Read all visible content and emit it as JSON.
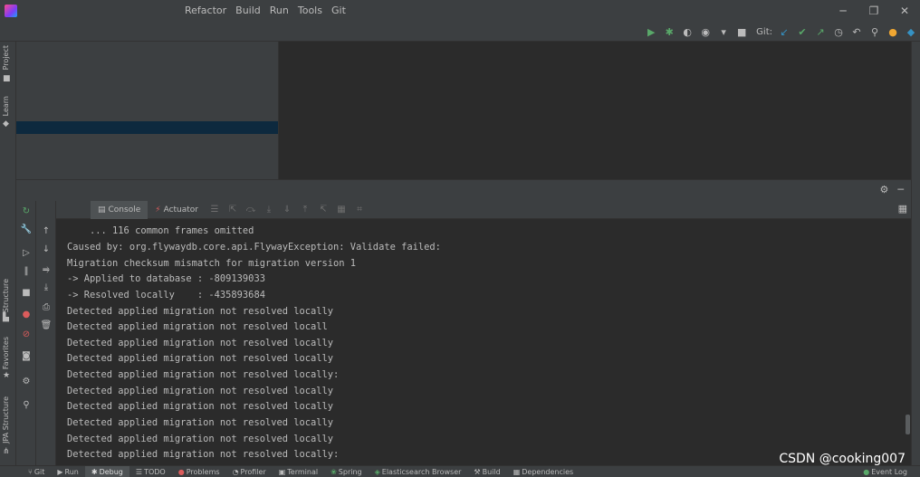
{
  "menu": [
    "Refactor",
    "Build",
    "Run",
    "Tools",
    "Git"
  ],
  "window_controls": [
    "─",
    "❐",
    "✕"
  ],
  "toolbar": {
    "git_label": "Git:"
  },
  "left_strip": {
    "tabs": [
      "Project",
      "Learn",
      "Structure",
      "Favorites",
      "JPA Structure"
    ]
  },
  "debug": {
    "tabs": [
      {
        "label": "Console",
        "icon": "console-icon"
      },
      {
        "label": "Actuator",
        "icon": "actuator-icon"
      }
    ]
  },
  "console": {
    "lines": [
      "    ... 116 common frames omitted",
      "Caused by: org.flywaydb.core.api.FlywayException: Validate failed:",
      "Migration checksum mismatch for migration version 1",
      "-> Applied to database : -809139033",
      "-> Resolved locally    : -435893684",
      "Detected applied migration not resolved locally",
      "Detected applied migration not resolved locall",
      "Detected applied migration not resolved locally",
      "Detected applied migration not resolved locally",
      "Detected applied migration not resolved locally:",
      "Detected applied migration not resolved locally",
      "Detected applied migration not resolved locally",
      "Detected applied migration not resolved locally",
      "Detected applied migration not resolved locally",
      "Detected applied migration not resolved locally:"
    ]
  },
  "bottom_tabs": [
    {
      "label": "Git",
      "icon": "git-icon",
      "active": false
    },
    {
      "label": "Run",
      "icon": "run-icon",
      "active": false
    },
    {
      "label": "Debug",
      "icon": "debug-icon",
      "active": true
    },
    {
      "label": "TODO",
      "icon": "todo-icon",
      "active": false
    },
    {
      "label": "Problems",
      "icon": "problems-icon",
      "active": false
    },
    {
      "label": "Profiler",
      "icon": "profiler-icon",
      "active": false
    },
    {
      "label": "Terminal",
      "icon": "terminal-icon",
      "active": false
    },
    {
      "label": "Spring",
      "icon": "spring-icon",
      "active": false
    },
    {
      "label": "Elasticsearch Browser",
      "icon": "elasticsearch-icon",
      "active": false
    },
    {
      "label": "Build",
      "icon": "build-icon",
      "active": false
    },
    {
      "label": "Dependencies",
      "icon": "dependencies-icon",
      "active": false
    }
  ],
  "event_log": "Event Log",
  "watermark": "CSDN @cooking007",
  "colors": {
    "background": "#2b2b2b",
    "panel": "#3c3f41",
    "text": "#bbbbbb",
    "selection": "#0d293e"
  }
}
